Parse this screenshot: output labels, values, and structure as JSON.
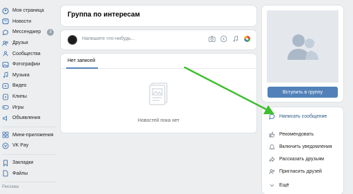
{
  "sidebar": {
    "items": [
      {
        "label": "Моя страница",
        "icon": "home-icon"
      },
      {
        "label": "Новости",
        "icon": "news-icon"
      },
      {
        "label": "Мессенджер",
        "icon": "messenger-icon",
        "badge": "3"
      },
      {
        "label": "Друзья",
        "icon": "friends-icon"
      },
      {
        "label": "Сообщества",
        "icon": "communities-icon"
      },
      {
        "label": "Фотографии",
        "icon": "photos-icon"
      },
      {
        "label": "Музыка",
        "icon": "music-icon"
      },
      {
        "label": "Видео",
        "icon": "video-icon"
      },
      {
        "label": "Клипы",
        "icon": "clips-icon"
      },
      {
        "label": "Игры",
        "icon": "games-icon"
      },
      {
        "label": "Объявления",
        "icon": "ads-icon"
      }
    ],
    "items2": [
      {
        "label": "Мини-приложения",
        "icon": "mini-apps-icon"
      },
      {
        "label": "VK Pay",
        "icon": "vk-pay-icon"
      }
    ],
    "items3": [
      {
        "label": "Закладки",
        "icon": "bookmarks-icon"
      },
      {
        "label": "Файлы",
        "icon": "files-icon"
      }
    ],
    "footer": "Реклама"
  },
  "header": {
    "title": "Группа по интересам"
  },
  "post_box": {
    "placeholder": "Напишите что-нибудь..."
  },
  "wall": {
    "tab": "Нет записей",
    "empty_text": "Новостей пока нет"
  },
  "group": {
    "join_label": "Вступить в группу"
  },
  "actions": [
    {
      "label": "Написать сообщение",
      "icon": "message-icon"
    },
    {
      "label": "Рекомендовать",
      "icon": "thumbs-up-icon"
    },
    {
      "label": "Включить уведомления",
      "icon": "bell-icon"
    },
    {
      "label": "Рассказать друзьям",
      "icon": "share-icon"
    },
    {
      "label": "Пригласить друзей",
      "icon": "invite-icon"
    },
    {
      "label": "Ещё",
      "icon": "chevron-down-icon"
    }
  ],
  "colors": {
    "background": "#edeef0",
    "accent": "#5181b8",
    "link": "#2a5885",
    "annotation_arrow": "#3fbf2f"
  }
}
